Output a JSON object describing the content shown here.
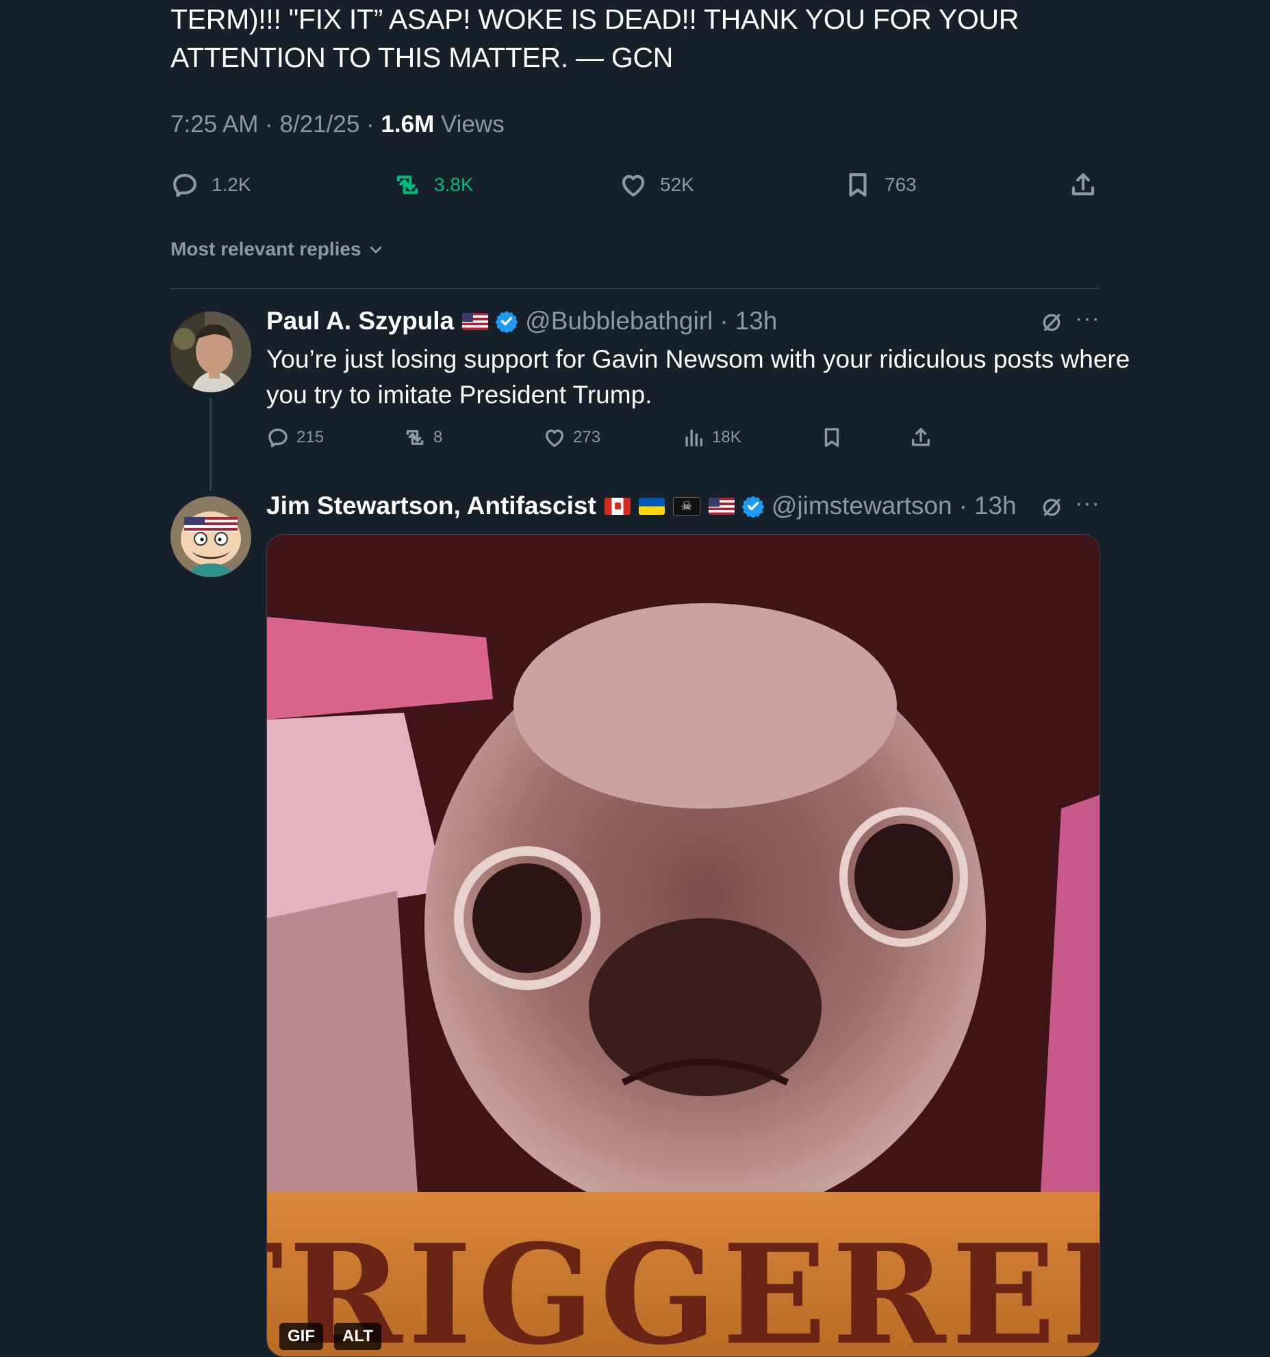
{
  "main_tweet": {
    "text": "TERM)!!! \"FIX IT” ASAP! WOKE IS DEAD!! THANK YOU FOR YOUR\nATTENTION TO THIS MATTER. — GCN",
    "time": "7:25 AM",
    "date": "8/21/25",
    "views_count": "1.6M",
    "views_label": "Views",
    "replies": "1.2K",
    "reposts": "3.8K",
    "likes": "52K",
    "bookmarks": "763"
  },
  "sort_label": "Most relevant replies",
  "replies": [
    {
      "name": "Paul A. Szypula",
      "handle": "@Bubblebathgirl",
      "age": "13h",
      "text": "You’re just losing support for Gavin Newsom with your ridiculous posts where you try to imitate President Trump.",
      "stats": {
        "replies": "215",
        "reposts": "8",
        "likes": "273",
        "views": "18K"
      }
    },
    {
      "name": "Jim Stewartson, Antifascist",
      "handle": "@jimstewartson",
      "age": "13h",
      "media_caption": "TRIGGERED",
      "badges": [
        "GIF",
        "ALT"
      ]
    }
  ],
  "colors": {
    "background": "#15202b",
    "muted": "#8b98a5",
    "repost_green": "#00ba7c",
    "verified_blue": "#1d9bf0"
  },
  "icons": [
    "reply-icon",
    "repost-icon",
    "like-icon",
    "bookmark-icon",
    "share-icon",
    "views-icon",
    "chevron-down-icon",
    "grok-icon",
    "more-icon",
    "verified-icon"
  ]
}
